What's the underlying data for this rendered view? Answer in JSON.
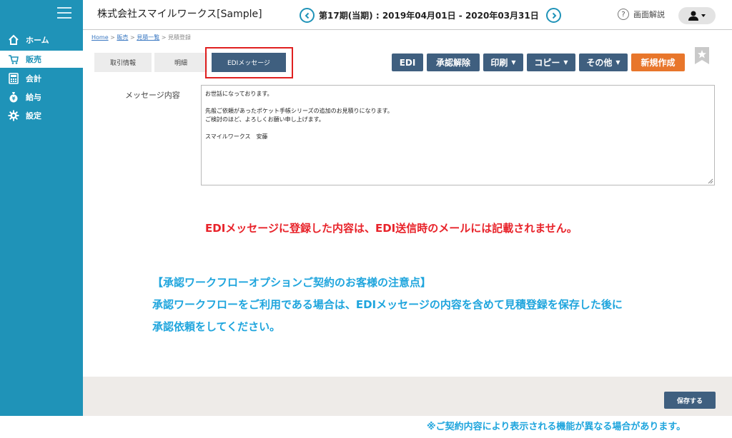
{
  "header": {
    "company": "株式会社スマイルワークス[Sample]",
    "period": "第17期(当期) : 2019年04月01日 - 2020年03月31日",
    "help_label": "画面解説"
  },
  "sidebar": {
    "items": [
      {
        "label": "ホーム",
        "icon": "home-icon"
      },
      {
        "label": "販売",
        "icon": "cart-icon"
      },
      {
        "label": "会計",
        "icon": "calculator-icon"
      },
      {
        "label": "給与",
        "icon": "moneybag-icon"
      },
      {
        "label": "設定",
        "icon": "gear-icon"
      }
    ],
    "active_index": 1
  },
  "breadcrumb": {
    "items": [
      "Home",
      "販売",
      "見積一覧",
      "見積登録"
    ],
    "separator": ">"
  },
  "tabs": [
    "取引情報",
    "明細",
    "EDIメッセージ"
  ],
  "active_tab": 2,
  "toolbar": {
    "edi": "EDI",
    "unapprove": "承認解除",
    "print": "印刷",
    "copy": "コピー",
    "other": "その他",
    "new": "新規作成"
  },
  "form": {
    "message_label": "メッセージ内容",
    "message_value": "お世話になっております。\n\n先般ご依頼があったポケット手帳シリーズの追加のお見積りになります。\nご検討のほど、よろしくお願い申し上げます。\n\nスマイルワークス　安藤"
  },
  "notices": {
    "red": "EDIメッセージに登録した内容は、EDI送信時のメールには記載されません。",
    "blue_title": "【承認ワークフローオプションご契約のお客様の注意点】",
    "blue_line1": "承認ワークフローをご利用である場合は、EDIメッセージの内容を含めて見積登録を保存した後に",
    "blue_line2": "承認依頼をしてください。"
  },
  "footer": {
    "save": "保存する",
    "note": "※ご契約内容により表示される機能が異なる場合があります。"
  },
  "colors": {
    "sidebar": "#1f93b8",
    "toolbar": "#3f5f7f",
    "new_button": "#e8762b",
    "notice_red": "#e8232a",
    "notice_blue": "#1fa5dd",
    "highlight": "#e02020"
  }
}
